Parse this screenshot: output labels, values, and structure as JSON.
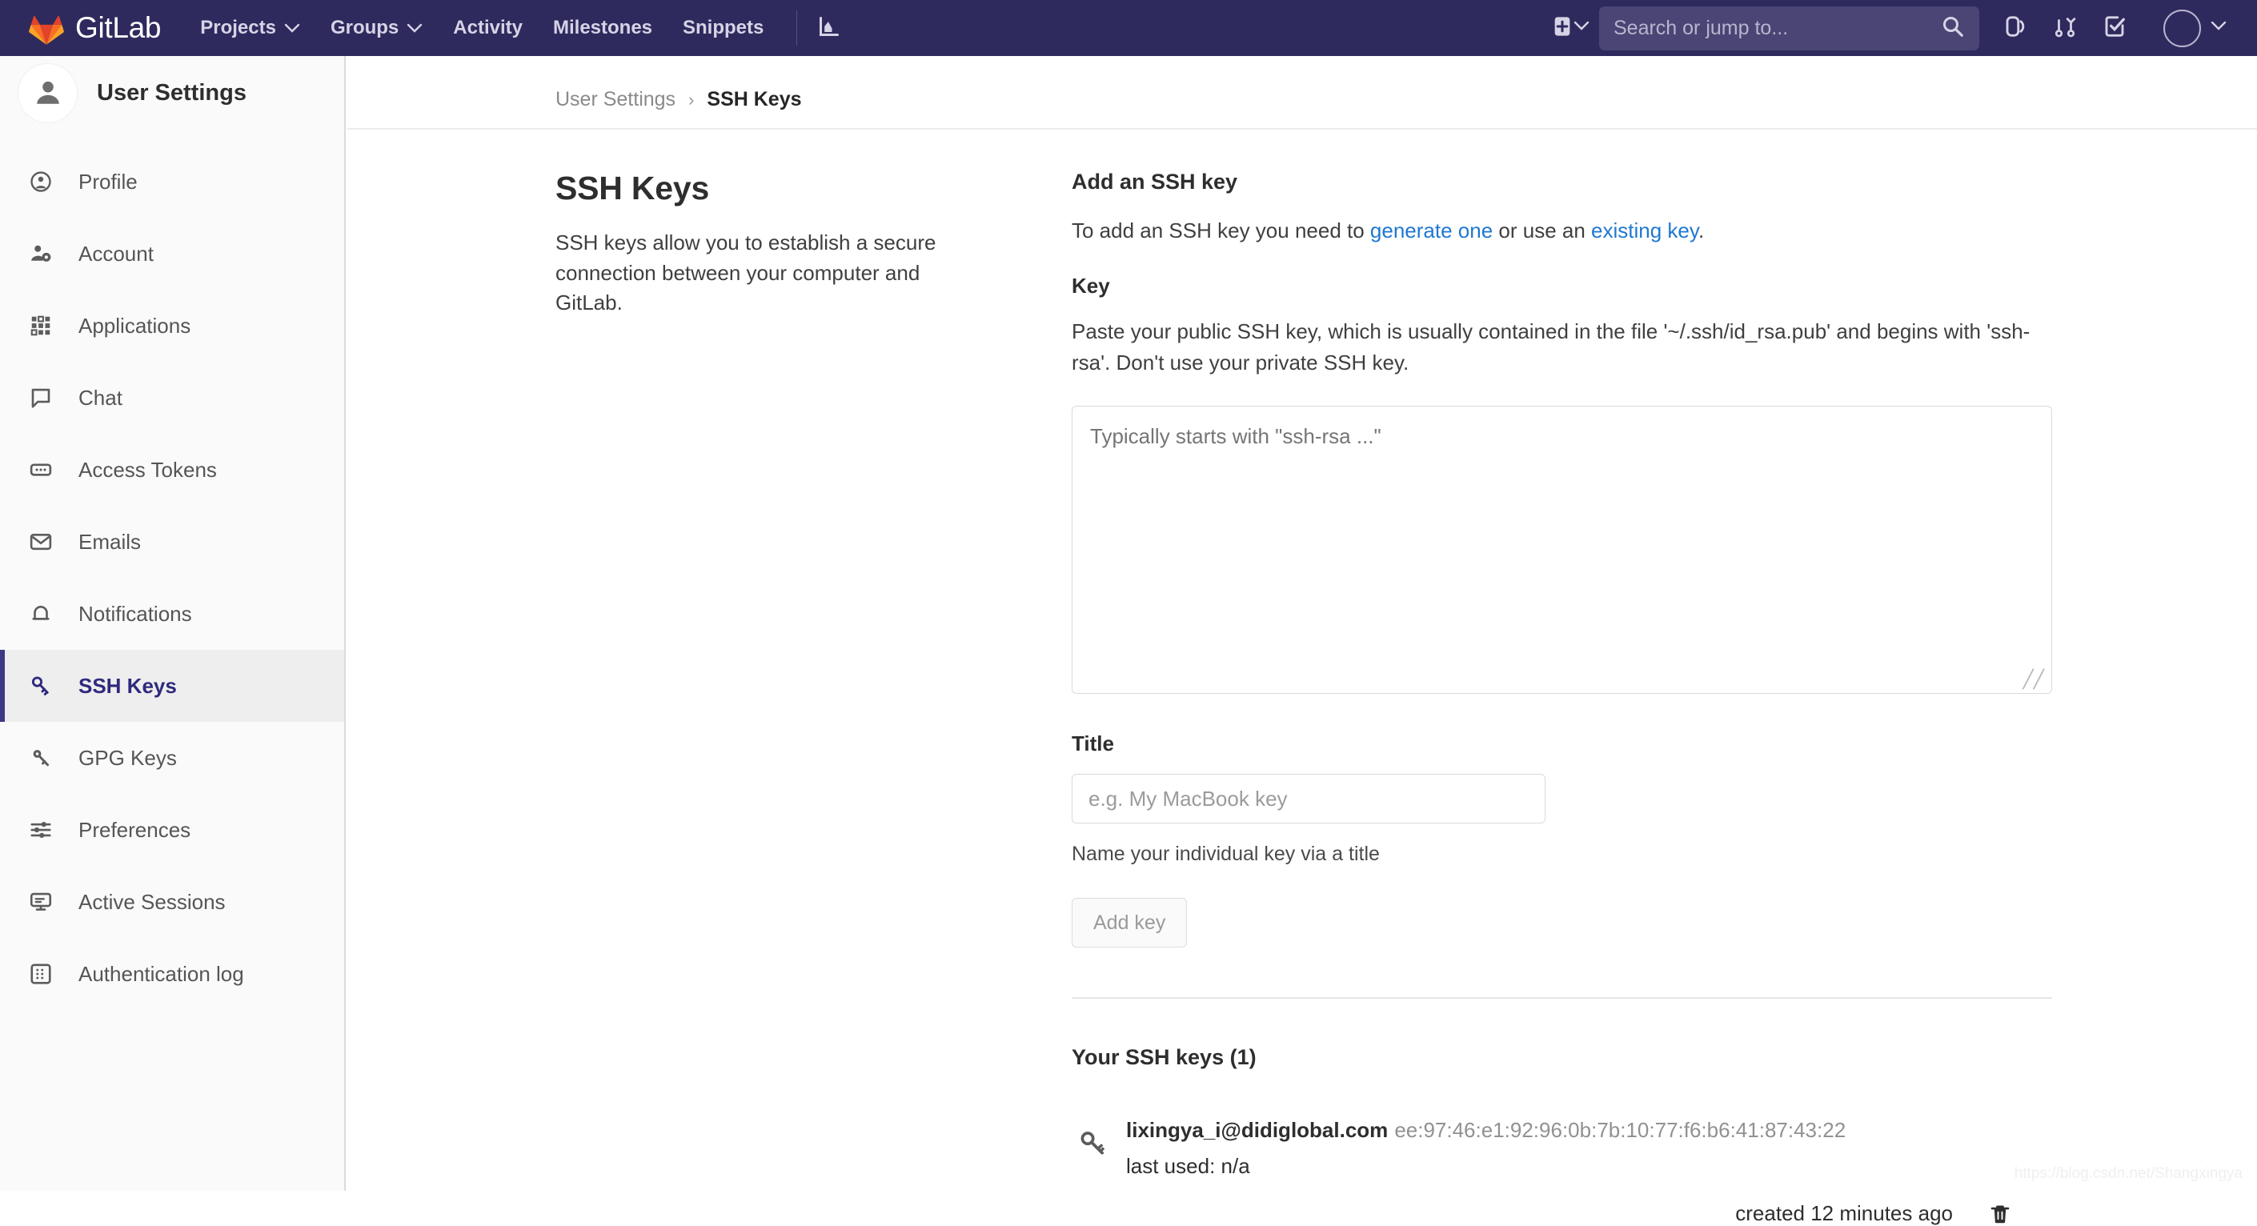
{
  "navbar": {
    "brand": "GitLab",
    "links": [
      {
        "label": "Projects",
        "has_caret": true
      },
      {
        "label": "Groups",
        "has_caret": true
      },
      {
        "label": "Activity",
        "has_caret": false
      },
      {
        "label": "Milestones",
        "has_caret": false
      },
      {
        "label": "Snippets",
        "has_caret": false
      }
    ],
    "analytics_icon": "chart-bar-icon",
    "plus_icon": "plus-square-icon",
    "plus_caret_icon": "chevron-down-icon",
    "search": {
      "placeholder": "Search or jump to...",
      "value": "",
      "icon": "search-icon"
    },
    "issues_icon": "issues-icon",
    "merge_requests_icon": "merge-request-icon",
    "todos_icon": "todo-check-icon",
    "avatar_icon": "user-avatar",
    "avatar_caret_icon": "chevron-down-icon",
    "background_color": "#2e2a5d"
  },
  "sidebar": {
    "title": "User Settings",
    "avatar_icon": "user-avatar-icon",
    "active_item": "SSH Keys",
    "accent_color": "#3c3885",
    "items": [
      {
        "label": "Profile",
        "icon": "profile-circle-icon",
        "active": false
      },
      {
        "label": "Account",
        "icon": "user-gear-icon",
        "active": false
      },
      {
        "label": "Applications",
        "icon": "grid-apps-icon",
        "active": false
      },
      {
        "label": "Chat",
        "icon": "chat-bubble-icon",
        "active": false
      },
      {
        "label": "Access Tokens",
        "icon": "token-icon",
        "active": false
      },
      {
        "label": "Emails",
        "icon": "envelope-icon",
        "active": false
      },
      {
        "label": "Notifications",
        "icon": "bell-icon",
        "active": false
      },
      {
        "label": "SSH Keys",
        "icon": "key-icon",
        "active": true
      },
      {
        "label": "GPG Keys",
        "icon": "key-icon",
        "active": false
      },
      {
        "label": "Preferences",
        "icon": "sliders-icon",
        "active": false
      },
      {
        "label": "Active Sessions",
        "icon": "monitor-icon",
        "active": false
      },
      {
        "label": "Authentication log",
        "icon": "log-list-icon",
        "active": false
      }
    ]
  },
  "breadcrumb": {
    "parent": "User Settings",
    "separator": "›",
    "current": "SSH Keys"
  },
  "page": {
    "title": "SSH Keys",
    "description": "SSH keys allow you to establish a secure connection between your computer and GitLab."
  },
  "add_key": {
    "heading": "Add an SSH key",
    "intro_prefix": "To add an SSH key you need to ",
    "link_generate": "generate one",
    "intro_middle": " or use an ",
    "link_existing": "existing key",
    "intro_suffix": ".",
    "key_label": "Key",
    "key_help": "Paste your public SSH key, which is usually contained in the file '~/.ssh/id_rsa.pub' and begins with 'ssh-rsa'. Don't use your private SSH key.",
    "key_placeholder": "Typically starts with \"ssh-rsa ...\"",
    "key_value": "",
    "title_label": "Title",
    "title_placeholder": "e.g. My MacBook key",
    "title_value": "",
    "title_hint": "Name your individual key via a title",
    "submit_label": "Add key",
    "submit_disabled": true,
    "link_color": "#1f78d1"
  },
  "keys_list": {
    "heading": "Your SSH keys (1)",
    "count": 1,
    "rows": [
      {
        "icon": "key-icon",
        "title": "lixingya_i@didiglobal.com",
        "fingerprint": "ee:97:46:e1:92:96:0b:7b:10:77:f6:b6:41:87:43:22",
        "last_used": "last used: n/a",
        "created": "created 12 minutes ago",
        "delete_icon": "trash-icon"
      }
    ]
  },
  "watermark": "https://blog.csdn.net/Shangxingya"
}
